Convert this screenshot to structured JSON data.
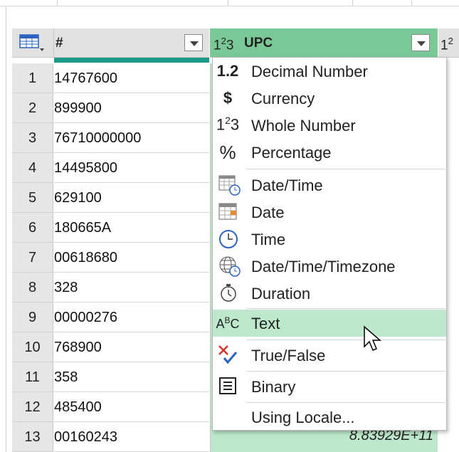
{
  "columns": {
    "first": {
      "header": "#"
    },
    "upc": {
      "type_icon": "whole-number-icon",
      "header": "UPC"
    }
  },
  "rows": [
    {
      "num": "1",
      "value": "14767600"
    },
    {
      "num": "2",
      "value": "899900"
    },
    {
      "num": "3",
      "value": "76710000000"
    },
    {
      "num": "4",
      "value": "14495800"
    },
    {
      "num": "5",
      "value": "629100"
    },
    {
      "num": "6",
      "value": "180665A"
    },
    {
      "num": "7",
      "value": "00618680"
    },
    {
      "num": "8",
      "value": "328"
    },
    {
      "num": "9",
      "value": "00000276"
    },
    {
      "num": "10",
      "value": "768900"
    },
    {
      "num": "11",
      "value": "358"
    },
    {
      "num": "12",
      "value": "485400"
    },
    {
      "num": "13",
      "value": "00160243",
      "upc": "8.83929E+11"
    }
  ],
  "menu": {
    "items": [
      {
        "label": "Decimal Number",
        "icon": "decimal-icon"
      },
      {
        "label": "Currency",
        "icon": "currency-icon"
      },
      {
        "label": "Whole Number",
        "icon": "whole-number-icon"
      },
      {
        "label": "Percentage",
        "icon": "percentage-icon"
      },
      {
        "label": "Date/Time",
        "icon": "datetime-icon"
      },
      {
        "label": "Date",
        "icon": "date-icon"
      },
      {
        "label": "Time",
        "icon": "time-icon"
      },
      {
        "label": "Date/Time/Timezone",
        "icon": "timezone-icon"
      },
      {
        "label": "Duration",
        "icon": "duration-icon"
      },
      {
        "label": "Text",
        "icon": "text-icon",
        "highlighted": true
      },
      {
        "label": "True/False",
        "icon": "true-false-icon"
      },
      {
        "label": "Binary",
        "icon": "binary-icon"
      },
      {
        "label": "Using Locale...",
        "icon": ""
      }
    ]
  },
  "colors": {
    "selected_column": "#7ac896",
    "selected_cell": "#bde8cc",
    "teal_bar": "#1b9b87"
  }
}
